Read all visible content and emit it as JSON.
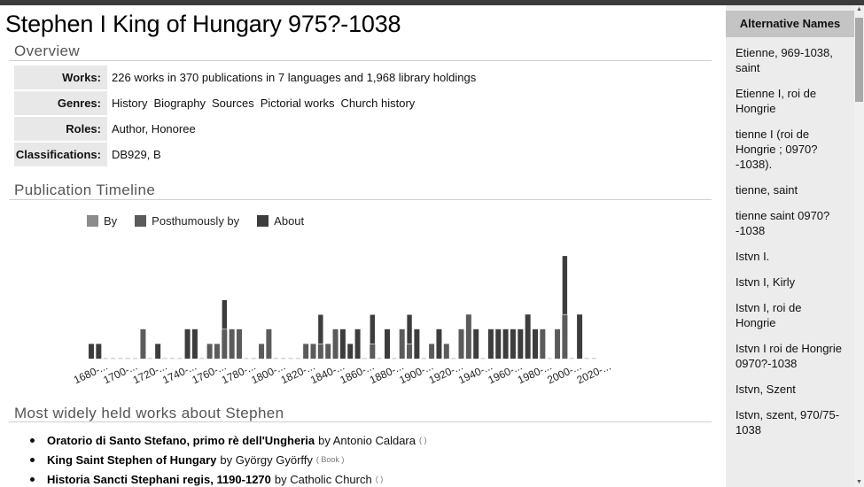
{
  "page": {
    "title": "Stephen I King of Hungary 975?-1038"
  },
  "overview": {
    "heading": "Overview",
    "rows": [
      {
        "label": "Works:",
        "value": "226 works in 370 publications in 7 languages and 1,968 library holdings"
      },
      {
        "label": "Genres:",
        "values": [
          "History",
          "Biography",
          "Sources",
          "Pictorial works",
          "Church history"
        ]
      },
      {
        "label": "Roles:",
        "value": "Author, Honoree"
      },
      {
        "label": "Classifications:",
        "value": "DB929, B"
      }
    ]
  },
  "timeline": {
    "heading": "Publication Timeline"
  },
  "chart_data": {
    "type": "bar",
    "stacked": true,
    "title": "Publication Timeline",
    "xlabel": "",
    "ylabel": "",
    "legend": "top-left",
    "legend_entries": [
      {
        "name": "By",
        "color": "#8c8c8c"
      },
      {
        "name": "Posthumously by",
        "color": "#5b5b5b"
      },
      {
        "name": "About",
        "color": "#3d3d3d"
      }
    ],
    "tick_labels": [
      "1680-...",
      "1700-...",
      "1720-...",
      "1740-...",
      "1760-...",
      "1780-...",
      "1800-...",
      "1820-...",
      "1840-...",
      "1860-...",
      "1880-...",
      "1900-...",
      "1920-...",
      "1940-...",
      "1960-...",
      "1980-...",
      "2000-...",
      "2020-..."
    ],
    "x_start": 1680,
    "x_step": 5,
    "slots": 69,
    "ylim": [
      0,
      7
    ],
    "series": [
      {
        "name": "By",
        "points": []
      },
      {
        "name": "Posthumously by",
        "points": [
          [
            1715,
            2
          ],
          [
            1760,
            1
          ],
          [
            1765,
            1
          ],
          [
            1770,
            2
          ],
          [
            1775,
            2
          ],
          [
            1780,
            2
          ],
          [
            1795,
            1
          ],
          [
            1800,
            2
          ],
          [
            1825,
            1
          ],
          [
            1830,
            1
          ],
          [
            1835,
            1
          ],
          [
            1840,
            1
          ],
          [
            1845,
            2
          ],
          [
            1870,
            1
          ],
          [
            1890,
            2
          ],
          [
            1895,
            1
          ],
          [
            1910,
            1
          ],
          [
            1920,
            1
          ],
          [
            1930,
            2
          ],
          [
            1935,
            3
          ],
          [
            1985,
            2
          ],
          [
            1995,
            2
          ],
          [
            2000,
            3
          ]
        ]
      },
      {
        "name": "About",
        "points": [
          [
            1680,
            1
          ],
          [
            1685,
            1
          ],
          [
            1725,
            1
          ],
          [
            1745,
            2
          ],
          [
            1750,
            2
          ],
          [
            1770,
            2
          ],
          [
            1835,
            2
          ],
          [
            1850,
            2
          ],
          [
            1855,
            1
          ],
          [
            1860,
            2
          ],
          [
            1870,
            2
          ],
          [
            1880,
            2
          ],
          [
            1895,
            2
          ],
          [
            1900,
            2
          ],
          [
            1915,
            2
          ],
          [
            1940,
            2
          ],
          [
            1950,
            2
          ],
          [
            1955,
            2
          ],
          [
            1960,
            2
          ],
          [
            1965,
            2
          ],
          [
            1970,
            2
          ],
          [
            1975,
            3
          ],
          [
            1980,
            2
          ],
          [
            2000,
            4
          ],
          [
            2010,
            3
          ]
        ]
      }
    ]
  },
  "works_list": {
    "heading": "Most widely held works about Stephen",
    "items": [
      {
        "title": "Oratorio di Santo Stefano, primo rè dell'Ungheria",
        "by": "by Antonio Caldara",
        "type": "( )"
      },
      {
        "title": "King Saint Stephen of Hungary",
        "by": "by György Györffy",
        "type": "( Book )"
      },
      {
        "title": "Historia Sancti Stephani regis, 1190-1270",
        "by": "by Catholic Church",
        "type": "( )"
      }
    ]
  },
  "sidebar": {
    "heading": "Alternative Names",
    "names": [
      "Etienne, 969-1038, saint",
      "Etienne I, roi de Hongrie",
      "tienne I (roi de Hongrie ; 0970? -1038).",
      "tienne, saint",
      "tienne saint 0970? -1038",
      "Istvn I.",
      "Istvn I, Kirly",
      "Istvn I, roi de Hongrie",
      "Istvn I roi de Hongrie 0970?-1038",
      "Istvn, Szent",
      "Istvn, szent, 970/75-1038"
    ]
  },
  "scrollbar": {
    "up_arrow_icon": "▲",
    "down_arrow_icon": "▼"
  }
}
